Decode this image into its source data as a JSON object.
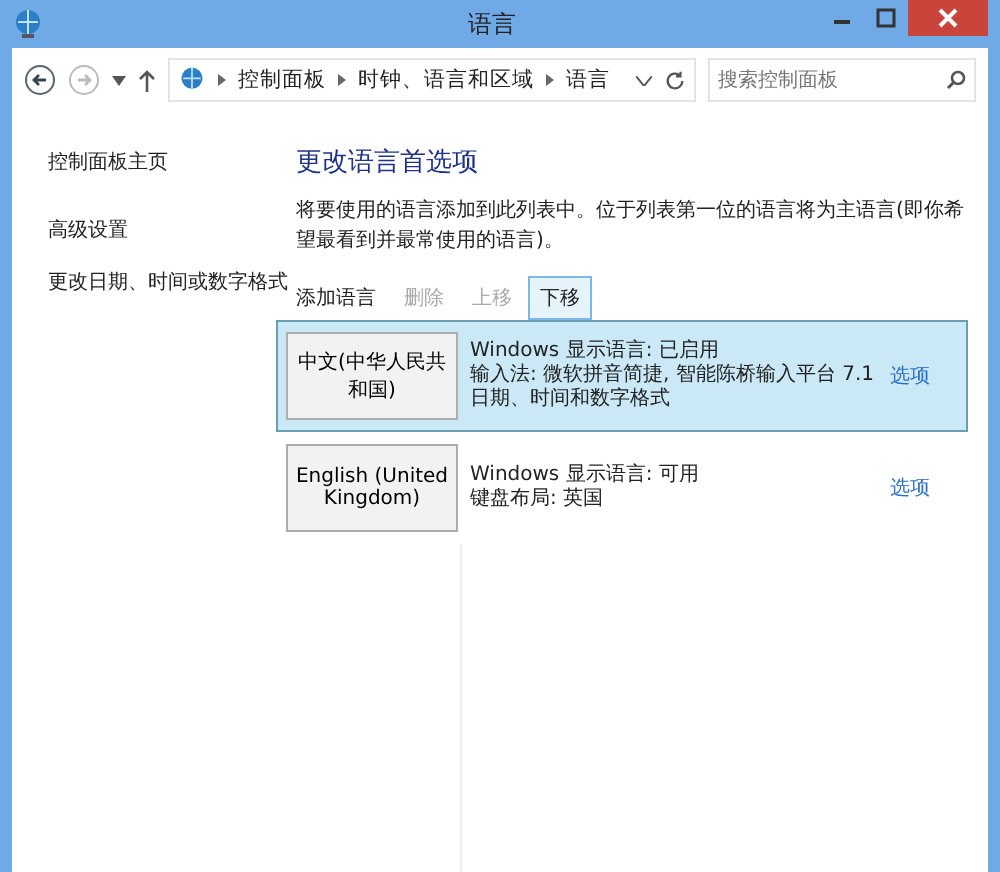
{
  "window": {
    "title": "语言"
  },
  "address_bar": {
    "breadcrumbs": [
      "控制面板",
      "时钟、语言和区域",
      "语言"
    ],
    "search_placeholder": "搜索控制面板"
  },
  "sidebar": {
    "items": [
      {
        "label": "控制面板主页"
      },
      {
        "label": "高级设置"
      },
      {
        "label": "更改日期、时间或数字格式"
      }
    ]
  },
  "main": {
    "heading": "更改语言首选项",
    "description": "将要使用的语言添加到此列表中。位于列表第一位的语言将为主语言(即你希望最看到并最常使用的语言)。",
    "toolbar": [
      {
        "label": "添加语言",
        "disabled": false,
        "selected": false
      },
      {
        "label": "删除",
        "disabled": true,
        "selected": false
      },
      {
        "label": "上移",
        "disabled": true,
        "selected": false
      },
      {
        "label": "下移",
        "disabled": false,
        "selected": true
      }
    ],
    "languages": [
      {
        "name": "中文(中华人民共和国)",
        "details": [
          "Windows 显示语言: 已启用",
          "输入法: 微软拼音简捷, 智能陈桥输入平台 7.1",
          "日期、时间和数字格式"
        ],
        "options": "选项",
        "selected": true
      },
      {
        "name": "English (United Kingdom)",
        "details": [
          "Windows 显示语言: 可用",
          "键盘布局: 英国"
        ],
        "options": "选项",
        "selected": false
      }
    ]
  }
}
